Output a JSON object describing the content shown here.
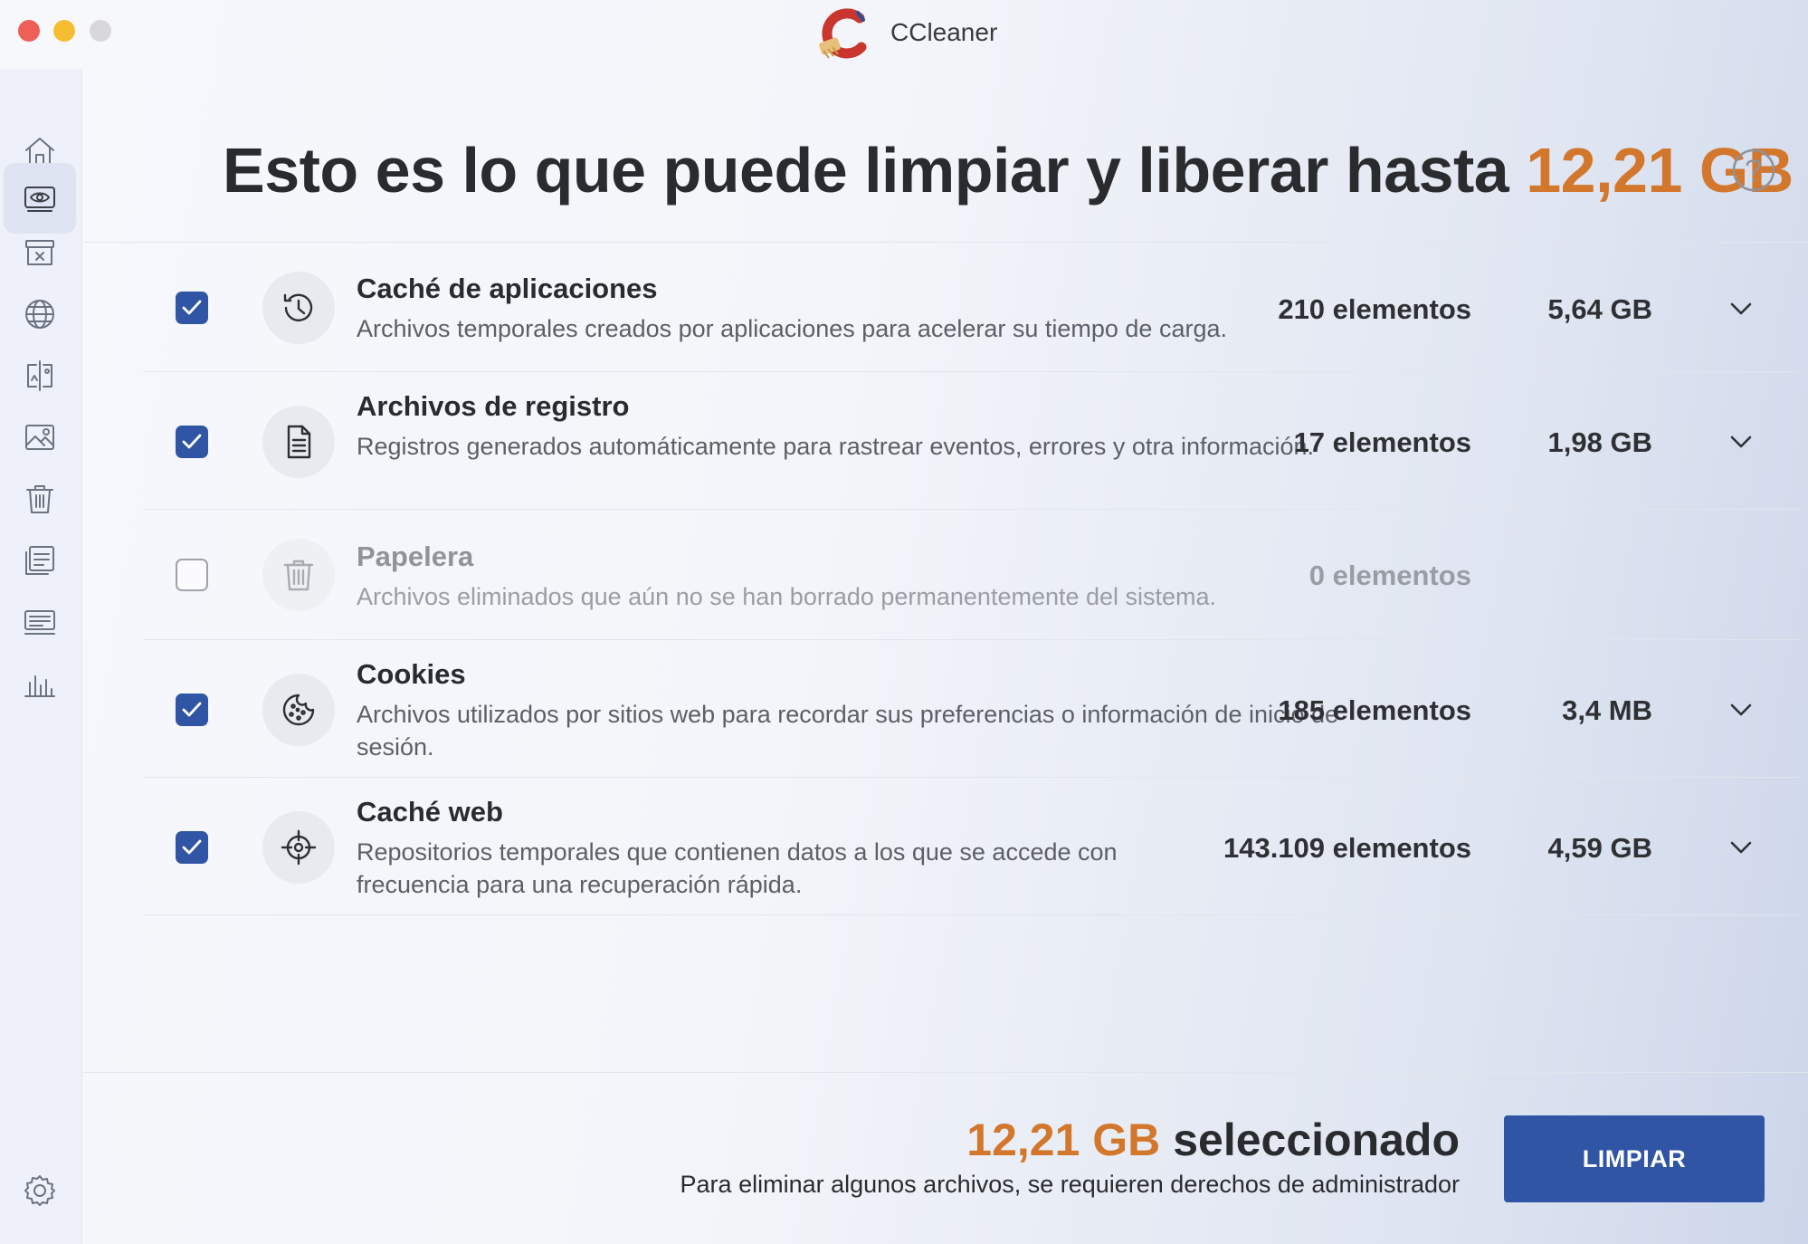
{
  "window": {
    "title": "CCleaner"
  },
  "sidebar": {
    "items": [
      {
        "icon": "home-icon"
      },
      {
        "icon": "eye-drive-icon",
        "active": true
      },
      {
        "icon": "archive-x-icon"
      },
      {
        "icon": "globe-icon"
      },
      {
        "icon": "compare-icon"
      },
      {
        "icon": "image-icon"
      },
      {
        "icon": "trash-icon"
      },
      {
        "icon": "list-icon"
      },
      {
        "icon": "keyboard-icon"
      },
      {
        "icon": "chart-icon"
      }
    ],
    "footer_icon": "gear-icon"
  },
  "header": {
    "headline_prefix": "Esto es lo que puede limpiar y liberar hasta",
    "headline_amount": "12,21 GB"
  },
  "items": [
    {
      "title": "Caché de aplicaciones",
      "description": "Archivos temporales creados por aplicaciones para acelerar su tiempo de carga.",
      "count": "210 elementos",
      "size": "5,64 GB",
      "checked": true,
      "icon": "history-icon"
    },
    {
      "title": "Archivos de registro",
      "description": "Registros generados automáticamente para rastrear eventos, errores y otra información.",
      "count": "17 elementos",
      "size": "1,98 GB",
      "checked": true,
      "icon": "document-icon"
    },
    {
      "title": "Papelera",
      "description": "Archivos eliminados que aún no se han borrado permanentemente del sistema.",
      "count": "0 elementos",
      "size": "",
      "checked": false,
      "icon": "trash-icon"
    },
    {
      "title": "Cookies",
      "description": "Archivos utilizados por sitios web para recordar sus preferencias o información de inicio de sesión.",
      "count": "185 elementos",
      "size": "3,4 MB",
      "checked": true,
      "icon": "cookie-icon"
    },
    {
      "title": "Caché web",
      "description": "Repositorios temporales que contienen datos a los que se accede con frecuencia para una recuperación rápida.",
      "count": "143.109 elementos",
      "size": "4,59 GB",
      "checked": true,
      "icon": "target-icon"
    }
  ],
  "footer": {
    "selected_amount": "12,21 GB",
    "selected_label": "seleccionado",
    "admin_note": "Para eliminar algunos archivos, se requieren derechos de administrador",
    "clean_button": "LIMPIAR"
  },
  "colors": {
    "accent": "#d3772c",
    "primary": "#2f55a4"
  }
}
